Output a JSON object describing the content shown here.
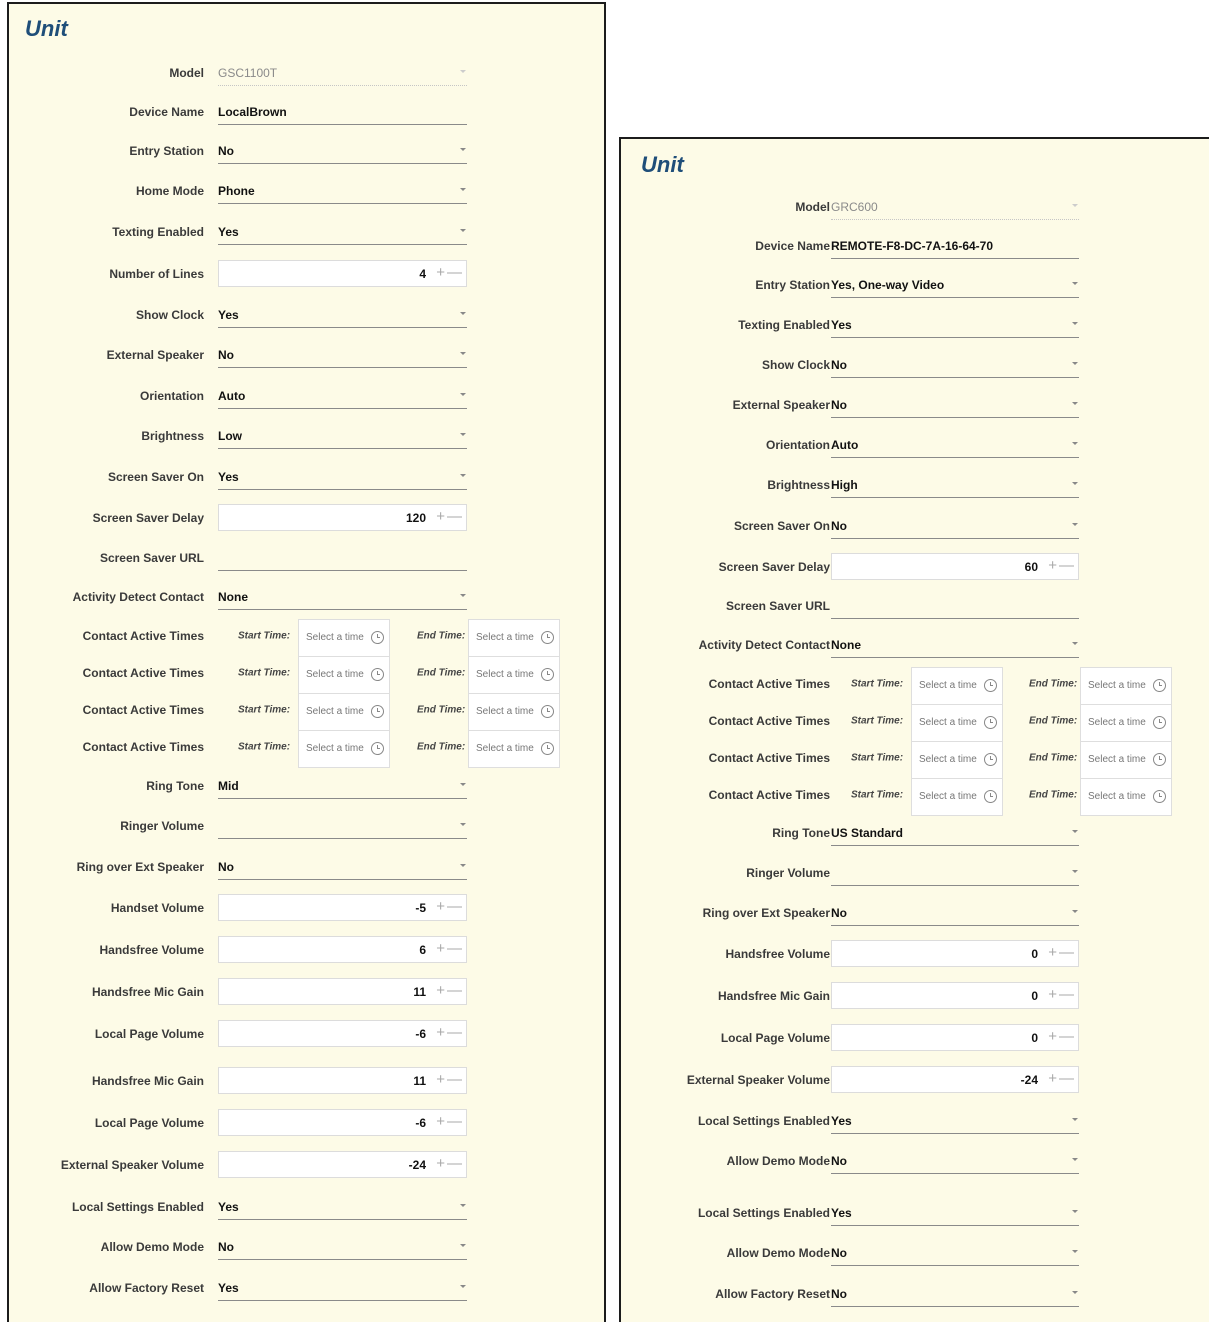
{
  "left": {
    "title": "Unit",
    "fields": {
      "model": {
        "label": "Model",
        "value": "GSC1100T"
      },
      "device_name": {
        "label": "Device Name",
        "value": "LocalBrown"
      },
      "entry_station": {
        "label": "Entry Station",
        "value": "No"
      },
      "home_mode": {
        "label": "Home Mode",
        "value": "Phone"
      },
      "texting_enabled": {
        "label": "Texting Enabled",
        "value": "Yes"
      },
      "number_of_lines": {
        "label": "Number of Lines",
        "value": "4"
      },
      "show_clock": {
        "label": "Show Clock",
        "value": "Yes"
      },
      "external_speaker": {
        "label": "External Speaker",
        "value": "No"
      },
      "orientation": {
        "label": "Orientation",
        "value": "Auto"
      },
      "brightness": {
        "label": "Brightness",
        "value": "Low"
      },
      "screen_saver_on": {
        "label": "Screen Saver On",
        "value": "Yes"
      },
      "screen_saver_delay": {
        "label": "Screen Saver Delay",
        "value": "120"
      },
      "screen_saver_url": {
        "label": "Screen Saver URL",
        "value": ""
      },
      "activity_detect_contact": {
        "label": "Activity Detect Contact",
        "value": "None"
      },
      "ring_tone": {
        "label": "Ring Tone",
        "value": "Mid"
      },
      "ringer_volume": {
        "label": "Ringer Volume",
        "value": ""
      },
      "ring_over_ext_speaker": {
        "label": "Ring over Ext Speaker",
        "value": "No"
      },
      "handset_volume": {
        "label": "Handset Volume",
        "value": "-5"
      },
      "handsfree_volume": {
        "label": "Handsfree Volume",
        "value": "6"
      },
      "handsfree_mic_gain_1": {
        "label": "Handsfree Mic Gain",
        "value": "11"
      },
      "local_page_volume_1": {
        "label": "Local Page Volume",
        "value": "-6"
      },
      "handsfree_mic_gain_2": {
        "label": "Handsfree Mic Gain",
        "value": "11"
      },
      "local_page_volume_2": {
        "label": "Local Page Volume",
        "value": "-6"
      },
      "external_speaker_volume": {
        "label": "External Speaker Volume",
        "value": "-24"
      },
      "local_settings_enabled": {
        "label": "Local Settings Enabled",
        "value": "Yes"
      },
      "allow_demo_mode": {
        "label": "Allow Demo Mode",
        "value": "No"
      },
      "allow_factory_reset": {
        "label": "Allow Factory Reset",
        "value": "Yes"
      }
    }
  },
  "right": {
    "title": "Unit",
    "fields": {
      "model": {
        "label": "Model",
        "value": "GRC600"
      },
      "device_name": {
        "label": "Device Name",
        "value": "REMOTE-F8-DC-7A-16-64-70"
      },
      "entry_station": {
        "label": "Entry Station",
        "value": "Yes, One-way Video"
      },
      "texting_enabled": {
        "label": "Texting Enabled",
        "value": "Yes"
      },
      "show_clock": {
        "label": "Show Clock",
        "value": "No"
      },
      "external_speaker": {
        "label": "External Speaker",
        "value": "No"
      },
      "orientation": {
        "label": "Orientation",
        "value": "Auto"
      },
      "brightness": {
        "label": "Brightness",
        "value": "High"
      },
      "screen_saver_on": {
        "label": "Screen Saver On",
        "value": "No"
      },
      "screen_saver_delay": {
        "label": "Screen Saver Delay",
        "value": "60"
      },
      "screen_saver_url": {
        "label": "Screen Saver URL",
        "value": ""
      },
      "activity_detect_contact": {
        "label": "Activity Detect Contact",
        "value": "None"
      },
      "ring_tone": {
        "label": "Ring Tone",
        "value": "US Standard"
      },
      "ringer_volume": {
        "label": "Ringer Volume",
        "value": ""
      },
      "ring_over_ext_speaker": {
        "label": "Ring over Ext Speaker",
        "value": "No"
      },
      "handsfree_volume": {
        "label": "Handsfree Volume",
        "value": "0"
      },
      "handsfree_mic_gain": {
        "label": "Handsfree Mic Gain",
        "value": "0"
      },
      "local_page_volume": {
        "label": "Local Page Volume",
        "value": "0"
      },
      "external_speaker_volume": {
        "label": "External Speaker Volume",
        "value": "-24"
      },
      "local_settings_enabled_1": {
        "label": "Local Settings Enabled",
        "value": "Yes"
      },
      "allow_demo_mode_1": {
        "label": "Allow Demo Mode",
        "value": "No"
      },
      "local_settings_enabled_2": {
        "label": "Local Settings Enabled",
        "value": "Yes"
      },
      "allow_demo_mode_2": {
        "label": "Allow Demo Mode",
        "value": "No"
      },
      "allow_factory_reset": {
        "label": "Allow Factory Reset",
        "value": "No"
      }
    }
  },
  "contact_times": {
    "label": "Contact Active Times",
    "start_label": "Start Time:",
    "end_label": "End Time:",
    "placeholder": "Select a time"
  },
  "stepper": {
    "plus": "+",
    "minus": "—"
  },
  "colors": {
    "title": "#1f4e79",
    "panel_bg": "#fdfbe7"
  },
  "icons": {
    "time_picker": "clock-icon",
    "dropdown": "chevron-down-icon"
  }
}
